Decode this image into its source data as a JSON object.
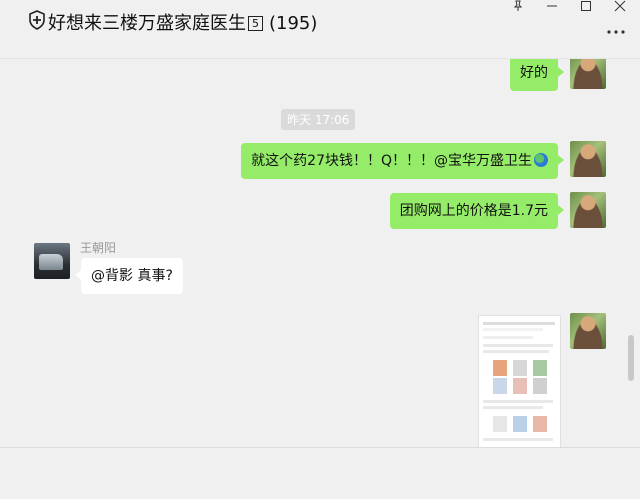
{
  "header": {
    "title": "好想来三楼万盛家庭医生🄄群 (195)",
    "title_display": "好想来三楼万盛家庭医生",
    "badge": "5",
    "count": "(195)",
    "title_icon": "shield-plus-icon",
    "more_icon": "more-dots-icon"
  },
  "window_controls": {
    "pin": "pin-icon",
    "minimize": "minimize-icon",
    "maximize": "maximize-icon",
    "close": "close-icon"
  },
  "messages": [
    {
      "from": "self",
      "type": "text",
      "text": "好的"
    },
    {
      "type": "timestamp",
      "text": "昨天 17:06"
    },
    {
      "from": "self",
      "type": "text",
      "text": "就这个药27块钱！！Q！！！@宝华万盛卫生",
      "emoji": "globe-emoji"
    },
    {
      "from": "self",
      "type": "text",
      "text": "团购网上的价格是1.7元"
    },
    {
      "from": "other",
      "sender": "王朝阳",
      "type": "text",
      "text": "@背影 真事?"
    },
    {
      "from": "self",
      "type": "image",
      "description_icon": "screenshot-thumbnail"
    }
  ],
  "colors": {
    "self_bubble": "#95ec69",
    "other_bubble": "#ffffff",
    "background": "#f0f0f0"
  }
}
